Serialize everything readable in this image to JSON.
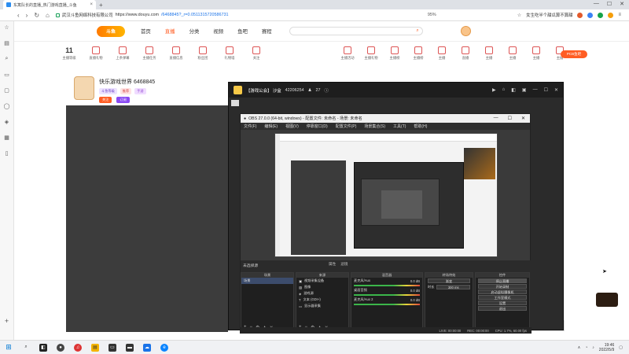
{
  "browser": {
    "tab_title": "东篱队长的直播_热门游戏直播_斗鱼",
    "url_host": "https://www.douyu.com",
    "url_path": "/6468845?_r=0.0511315720586731",
    "url_prefix": "武汉斗鱼网络科技有限公司",
    "zoom": "95%",
    "search_hint": "女生吃半个甜瓜算不算甜",
    "new_tab": "+",
    "close_tab": "×"
  },
  "douyu": {
    "logo": "斗鱼",
    "menu": [
      "首页",
      "直播",
      "分类",
      "视频",
      "鱼吧",
      "赛程"
    ],
    "active_menu": "直播",
    "search_placeholder": "",
    "stats": [
      {
        "num": "11",
        "label": "主播等级"
      },
      {
        "label": "直播礼物"
      },
      {
        "label": "上条弹幕"
      },
      {
        "label": "主播任务"
      },
      {
        "label": "直播信息"
      },
      {
        "label": "粉丝团"
      },
      {
        "label": "礼物墙"
      },
      {
        "label": "关注"
      }
    ],
    "stats_right": [
      {
        "label": "主播活动"
      },
      {
        "label": "主播礼物"
      },
      {
        "label": "主播榜"
      },
      {
        "label": "主播榜"
      },
      {
        "label": "主播"
      },
      {
        "label": "直播"
      },
      {
        "label": "主播"
      },
      {
        "label": "主播"
      },
      {
        "label": "主播"
      },
      {
        "label": "主播"
      }
    ],
    "fish_bar": "PCB鱼吧",
    "streamer_name": "快乐游戏世界 6468845",
    "tags": [
      "斗鱼等级",
      "推荐",
      "手游"
    ],
    "follow_labels": [
      "关注",
      "订阅"
    ]
  },
  "obs": {
    "room_title": "【游戏公会】 沙盒",
    "room_id": "42206254",
    "online_count": "27",
    "window_title": "OBS 27.0.0 (64-bit, windows) - 配置文件: 未命名 - 场景: 未命名",
    "menus": [
      "文件(F)",
      "编辑(E)",
      "视图(V)",
      "停靠窗口(D)",
      "配置文件(P)",
      "场景集合(S)",
      "工具(T)",
      "帮助(H)"
    ],
    "no_scene": "未选择源",
    "controls_top": [
      "属性",
      "滤镜"
    ],
    "panes": {
      "scenes_header": "场景",
      "scenes": [
        "场景"
      ],
      "sources_header": "来源",
      "sources": [
        "视频采集设备",
        "图像",
        "游戏源",
        "文本 (GDI+)",
        "显示器采集"
      ],
      "mixer_header": "混音器",
      "mixer_items": [
        {
          "name": "麦克风/Aux",
          "db": "0.0 dB"
        },
        {
          "name": "桌面音频",
          "db": "0.0 dB"
        },
        {
          "name": "麦克风/Aux 2",
          "db": "0.0 dB"
        }
      ],
      "transitions_header": "转场特效",
      "transition": "渐变",
      "duration_label": "时长",
      "duration": "300 ms",
      "controls_header": "控件",
      "controls": [
        "停止直播",
        "开始录制",
        "启动虚拟摄像机",
        "工作室模式",
        "设置",
        "退出"
      ]
    },
    "status": [
      "LIVE: 00:00:00",
      "REC: 00:00:00",
      "CPU: 1.7%, 60.00 fps"
    ]
  },
  "taskbar": {
    "time": "19:46",
    "date": "2022/5/9"
  }
}
